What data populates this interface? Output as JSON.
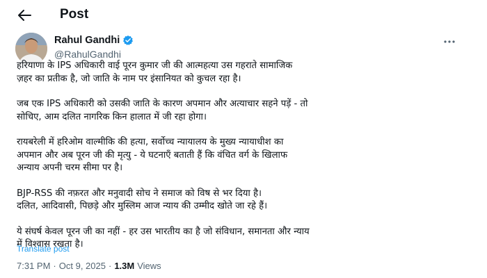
{
  "header": {
    "title": "Post"
  },
  "author": {
    "name": "Rahul Gandhi",
    "handle": "@RahulGandhi",
    "verified": true,
    "verified_color": "#1d9bf0"
  },
  "post": {
    "paragraphs": [
      "हरियाणा के IPS अधिकारी वाई पूरन कुमार जी की आत्महत्या उस गहराते सामाजिक\nज़हर का प्रतीक है, जो जाति के नाम पर इंसानियत को कुचल रहा है।",
      "जब एक IPS अधिकारी को उसकी जाति के कारण अपमान और अत्याचार सहने पड़ें - तो\nसोचिए, आम दलित नागरिक किन हालात में जी रहा होगा।",
      "रायबरेली में हरिओम वाल्मीकि की हत्या, सर्वोच्च न्यायालय के मुख्य न्यायाधीश का\nअपमान और अब पूरन जी की मृत्यु - ये घटनाएँ बताती हैं कि वंचित वर्ग के खिलाफ\nअन्याय अपनी चरम सीमा पर है।",
      "BJP-RSS की नफ़रत और मनुवादी सोच ने समाज को विष से भर दिया है।\nदलित, आदिवासी, पिछड़े और मुस्लिम आज न्याय की उम्मीद खोते जा रहे हैं।",
      "ये संघर्ष केवल पूरन जी का नहीं - हर उस भारतीय का है जो संविधान, समानता और न्याय\nमें विश्वास रखता है।"
    ],
    "translate_label": "Translate post",
    "time": "7:31 PM",
    "date": "Oct 9, 2025",
    "separator": "·",
    "views_count": "1.3M",
    "views_label": "Views"
  },
  "icons": {
    "back": "arrow-left-icon",
    "verified": "verified-badge-icon",
    "more": "more-horizontal-icon"
  },
  "colors": {
    "accent": "#1d9bf0",
    "text_primary": "#0f1419",
    "text_secondary": "#536471"
  }
}
